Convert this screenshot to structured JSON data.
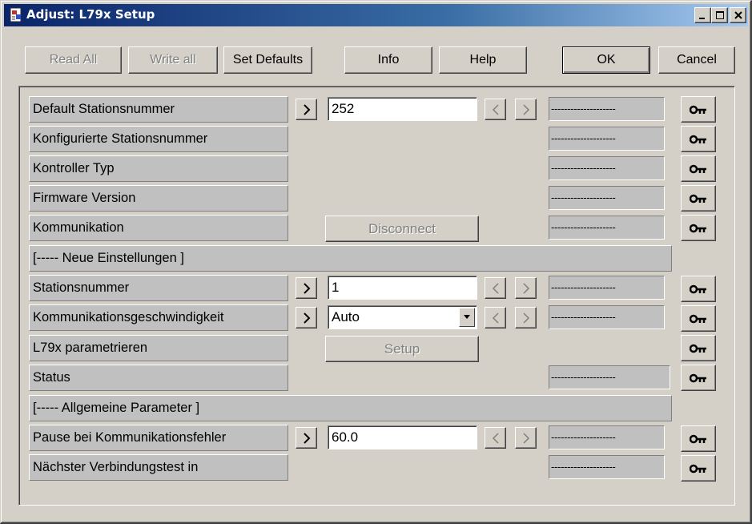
{
  "window": {
    "title": "Adjust: L79x Setup"
  },
  "toolbar": {
    "read_all": "Read All",
    "write_all": "Write all",
    "set_defaults": "Set Defaults",
    "info": "Info",
    "help": "Help",
    "ok": "OK",
    "cancel": "Cancel"
  },
  "rows": {
    "default_stationsnummer": {
      "label": "Default Stationsnummer",
      "value": "252",
      "status": "--------------------"
    },
    "konfigurierte_stationsnummer": {
      "label": "Konfigurierte Stationsnummer",
      "status": "--------------------"
    },
    "kontroller_typ": {
      "label": "Kontroller Typ",
      "status": "--------------------"
    },
    "firmware_version": {
      "label": "Firmware Version",
      "status": "--------------------"
    },
    "kommunikation": {
      "label": "Kommunikation",
      "action": "Disconnect",
      "status": "--------------------"
    },
    "neue_einstellungen": {
      "label": "[----- Neue Einstellungen ]"
    },
    "stationsnummer": {
      "label": "Stationsnummer",
      "value": "1",
      "status": "--------------------"
    },
    "kommunikationsgeschwindigkeit": {
      "label": "Kommunikationsgeschwindigkeit",
      "value": "Auto",
      "status": "--------------------"
    },
    "l79x_parametrieren": {
      "label": "L79x parametrieren",
      "action": "Setup"
    },
    "status": {
      "label": "Status",
      "status": "--------------------"
    },
    "allgemeine_parameter": {
      "label": "[----- Allgemeine Parameter ]"
    },
    "pause_kommunikationsfehler": {
      "label": "Pause bei Kommunikationsfehler",
      "value": "60.0",
      "status": "--------------------"
    },
    "naechster_verbindungstest": {
      "label": "Nächster Verbindungstest in",
      "status": "--------------------"
    }
  },
  "icons": {
    "app": "app-document-icon",
    "minimize": "minimize-icon",
    "maximize": "maximize-icon",
    "close": "close-icon",
    "apply": "chevron-right-icon",
    "decrement": "arrow-left-icon",
    "increment": "arrow-right-icon",
    "key": "key-icon",
    "dropdown": "dropdown-arrow-icon"
  },
  "colors": {
    "titlebar_start": "#0a246a",
    "titlebar_end": "#a6caf0",
    "face": "#d4d0c8",
    "cell": "#c0c0c0"
  }
}
